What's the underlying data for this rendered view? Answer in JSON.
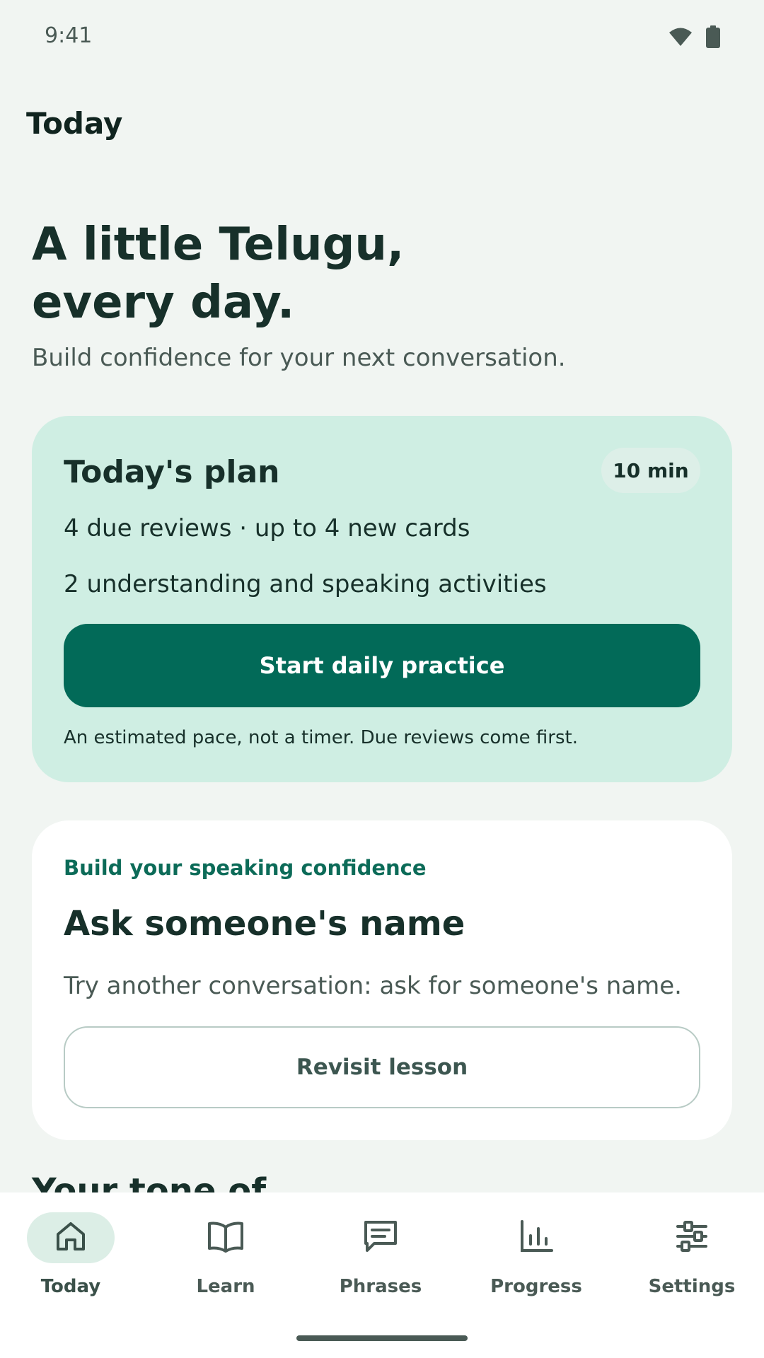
{
  "status_bar": {
    "time": "9:41",
    "icons": [
      "wifi-icon",
      "battery-icon"
    ]
  },
  "app_bar": {
    "title": "Today"
  },
  "hero": {
    "title_line1": "A little Telugu,",
    "title_line2": "every day.",
    "subtitle": "Build confidence for your next conversation."
  },
  "plan": {
    "title": "Today's plan",
    "duration_badge": "10 min",
    "line1": "4 due reviews · up to 4 new cards",
    "line2": "2 understanding and speaking activities",
    "button_label": "Start daily practice",
    "note": "An estimated pace, not a timer. Due reviews come first."
  },
  "lesson": {
    "eyebrow": "Build your speaking confidence",
    "title": "Ask someone's name",
    "description": "Try another conversation: ask for someone's name.",
    "button_label": "Revisit lesson"
  },
  "next_section": {
    "heading": "Your tone of..."
  },
  "bottom_nav": {
    "items": [
      {
        "label": "Today",
        "icon": "home-icon",
        "active": true
      },
      {
        "label": "Learn",
        "icon": "book-icon",
        "active": false
      },
      {
        "label": "Phrases",
        "icon": "chat-icon",
        "active": false
      },
      {
        "label": "Progress",
        "icon": "bar-chart-icon",
        "active": false
      },
      {
        "label": "Settings",
        "icon": "sliders-icon",
        "active": false
      }
    ]
  },
  "colors": {
    "background": "#F1F5F2",
    "accent": "#026A58",
    "plan_card": "#CFEEE3",
    "text_primary": "#17302A",
    "text_secondary": "#4A5A55"
  }
}
